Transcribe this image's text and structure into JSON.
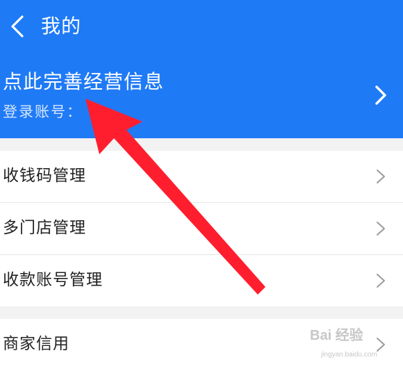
{
  "header": {
    "title": "我的",
    "back_icon": "chevron-left-icon"
  },
  "profile": {
    "title": "点此完善经营信息",
    "subtitle": "登录账号：",
    "chevron_icon": "chevron-right-icon"
  },
  "menu_group_1": [
    {
      "label": "收钱码管理",
      "icon": "chevron-right-icon"
    },
    {
      "label": "多门店管理",
      "icon": "chevron-right-icon"
    },
    {
      "label": "收款账号管理",
      "icon": "chevron-right-icon"
    }
  ],
  "menu_group_2": [
    {
      "label": "商家信用",
      "icon": "chevron-right-icon"
    }
  ],
  "annotation": {
    "arrow_color": "#ff1e2e"
  },
  "watermark": {
    "main": "Bai 经验",
    "sub": "jingyan.baidu.com"
  },
  "colors": {
    "header_bg": "#1f7af6",
    "page_bg": "#f2f2f2"
  }
}
